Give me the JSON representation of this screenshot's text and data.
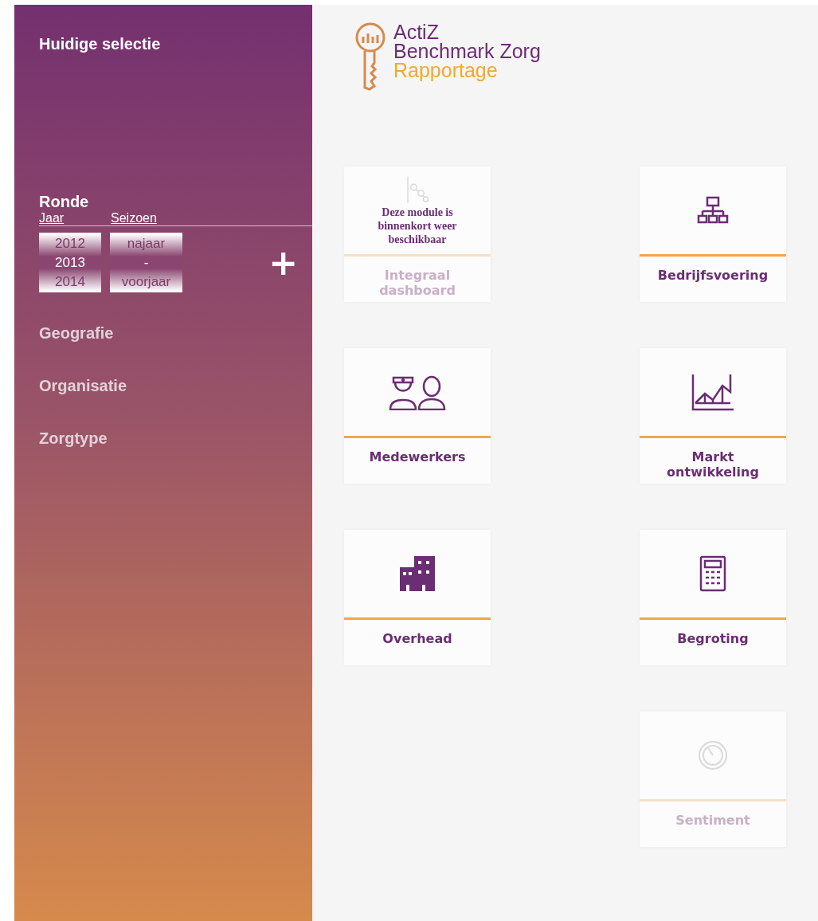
{
  "sidebar": {
    "title": "Huidige selectie",
    "sections": [
      {
        "label": "Ronde",
        "expanded": true
      },
      {
        "label": "Geografie",
        "expanded": false
      },
      {
        "label": "Organisatie",
        "expanded": false
      },
      {
        "label": "Zorgtype",
        "expanded": false
      }
    ],
    "ronde": {
      "columns": [
        "Jaar",
        "Seizoen"
      ],
      "pickers": [
        {
          "options": [
            {
              "label": "2012",
              "selected": false
            },
            {
              "label": "2013",
              "selected": true
            },
            {
              "label": "2014",
              "selected": false
            }
          ]
        },
        {
          "options": [
            {
              "label": "najaar",
              "selected": false
            },
            {
              "label": "-",
              "selected": true
            },
            {
              "label": "voorjaar",
              "selected": false
            }
          ]
        }
      ],
      "add_button": "+"
    }
  },
  "logo": {
    "lines": [
      "ActiZ",
      "Benchmark Zorg",
      "Rapportage"
    ]
  },
  "tiles": [
    {
      "label": "Integraal dashboard",
      "disabled": true,
      "notice": "Deze module is binnenkort weer beschikbaar"
    },
    {
      "label": "Bedrijfsvoering",
      "disabled": false
    },
    {
      "label": "Medewerkers",
      "disabled": false
    },
    {
      "label": "Markt ontwikkeling",
      "disabled": false
    },
    {
      "label": "Overhead",
      "disabled": false
    },
    {
      "label": "Begroting",
      "disabled": false
    },
    {
      "label": "Sentiment",
      "disabled": true
    }
  ]
}
